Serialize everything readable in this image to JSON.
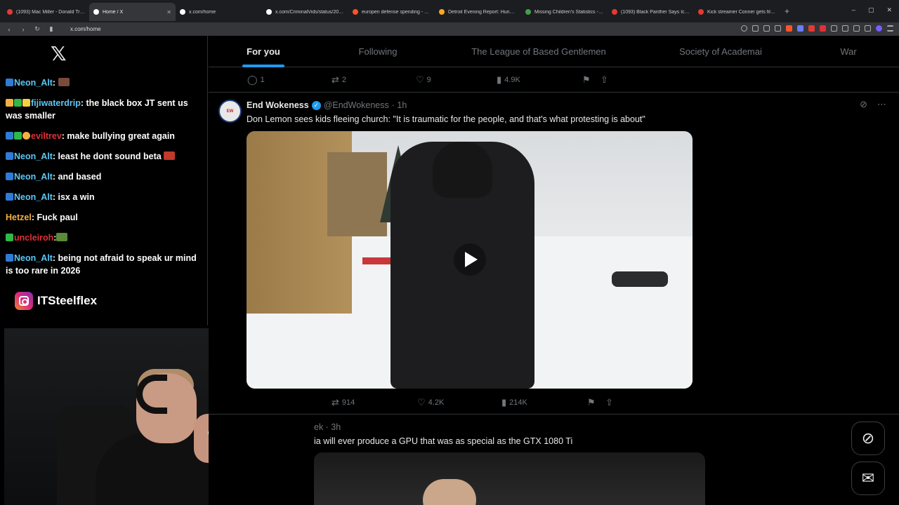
{
  "browser": {
    "tabs": [
      {
        "title": "(1093) Mac Miller - Donald Trump - Y",
        "color": "#e53935"
      },
      {
        "title": "Home / X",
        "color": "#ffffff",
        "active": true
      },
      {
        "title": "x.com/home",
        "color": "#ffffff"
      },
      {
        "title": "x.com/CriminalVids/status/20123159",
        "color": "#ffffff"
      },
      {
        "title": "europen defense spending - Brave Se",
        "color": "#fb542b"
      },
      {
        "title": "Detroit Evening Report: Hundreds in",
        "color": "#f9a825"
      },
      {
        "title": "Missing Children's Statistics - Global",
        "color": "#43a047"
      },
      {
        "title": "(1093) Black Panther Says Ice Is Goin",
        "color": "#e53935"
      },
      {
        "title": "Kick streamer Conner gets filmed by",
        "color": "#e53935"
      }
    ],
    "new_tab": "+",
    "url": "x.com/home",
    "controls": [
      "–",
      "▢",
      "✕"
    ]
  },
  "chat": {
    "messages": [
      {
        "user": "Neon_Alt",
        "user_color": "#5bc8f5",
        "text": ":"
      },
      {
        "user": "fijiwaterdrip",
        "user_color": "#5bc8f5",
        "text": ": the black box JT sent us was smaller"
      },
      {
        "user": "eviltrev",
        "user_color": "#e0303a",
        "text": ": make bullying great again"
      },
      {
        "user": "Neon_Alt",
        "user_color": "#5bc8f5",
        "text": ": least he dont sound beta"
      },
      {
        "user": "Neon_Alt",
        "user_color": "#5bc8f5",
        "text": ": and based"
      },
      {
        "user": "Neon_Alt",
        "user_color": "#5bc8f5",
        "text": ": isx a win"
      },
      {
        "user": "Hetzel",
        "user_color": "#f5b041",
        "text": ": Fuck paul"
      },
      {
        "user": "uncleiroh",
        "user_color": "#e0303a",
        "text": ":"
      },
      {
        "user": "Neon_Alt",
        "user_color": "#5bc8f5",
        "text": ": being not afraid to speak ur mind is too rare in 2026"
      }
    ],
    "instagram_handle": "ITSteelflex"
  },
  "feed": {
    "tabs": [
      "For you",
      "Following",
      "The League of Based Gentlemen",
      "Society of Academai",
      "War"
    ],
    "prev_post_stats": {
      "replies": "1",
      "reposts": "2",
      "likes": "9",
      "views": "4.9K"
    },
    "post": {
      "name": "End Wokeness",
      "handle": "@EndWokeness",
      "time": "· 1h",
      "text": "Don Lemon sees kids fleeing church: \"It is traumatic for the people, and that's what protesting is about\"",
      "stats": {
        "reposts": "914",
        "likes": "4.2K",
        "views": "214K"
      }
    },
    "next_post": {
      "meta": "ek · 3h",
      "text": "ia will ever produce a GPU that was as special as the GTX 1080 Ti"
    }
  },
  "colors": {
    "accent": "#1d9bf0",
    "background": "#000000",
    "muted": "#71767b"
  }
}
